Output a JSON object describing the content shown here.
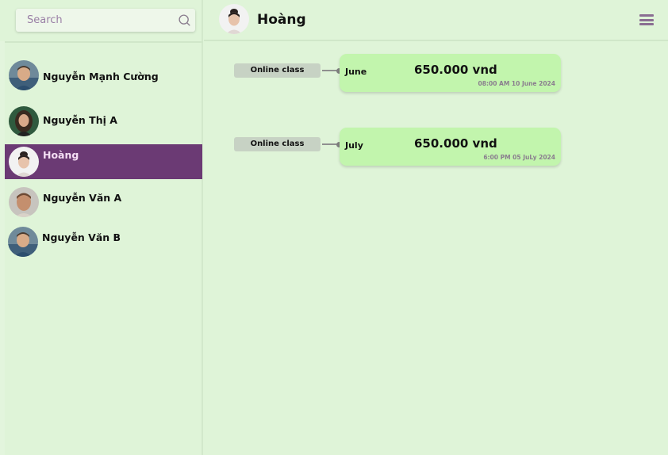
{
  "search": {
    "placeholder": "Search",
    "icon": "search-icon"
  },
  "contacts": [
    {
      "name": "Nguyễn Mạnh Cường",
      "active": false
    },
    {
      "name": "Nguyễn Thị A",
      "active": false
    },
    {
      "name": "Hoàng",
      "active": true
    },
    {
      "name": "Nguyễn Văn A",
      "active": false
    },
    {
      "name": "Nguyễn Văn B",
      "active": false
    }
  ],
  "header": {
    "title": "Hoàng",
    "menu_icon": "hamburger-menu-icon"
  },
  "payments": [
    {
      "tag": "Online class",
      "month": "June",
      "amount": "650.000 vnd",
      "time": "08:00 AM 10 June 2024"
    },
    {
      "tag": "Online class",
      "month": "July",
      "amount": "650.000 vnd",
      "time": "6:00 PM 05 JuLy 2024"
    }
  ],
  "colors": {
    "background": "#dff4d8",
    "active": "#6b3a74",
    "card": "#c2f5ad",
    "tag": "#c7d2c4",
    "muted_text": "#8a7d8e"
  }
}
